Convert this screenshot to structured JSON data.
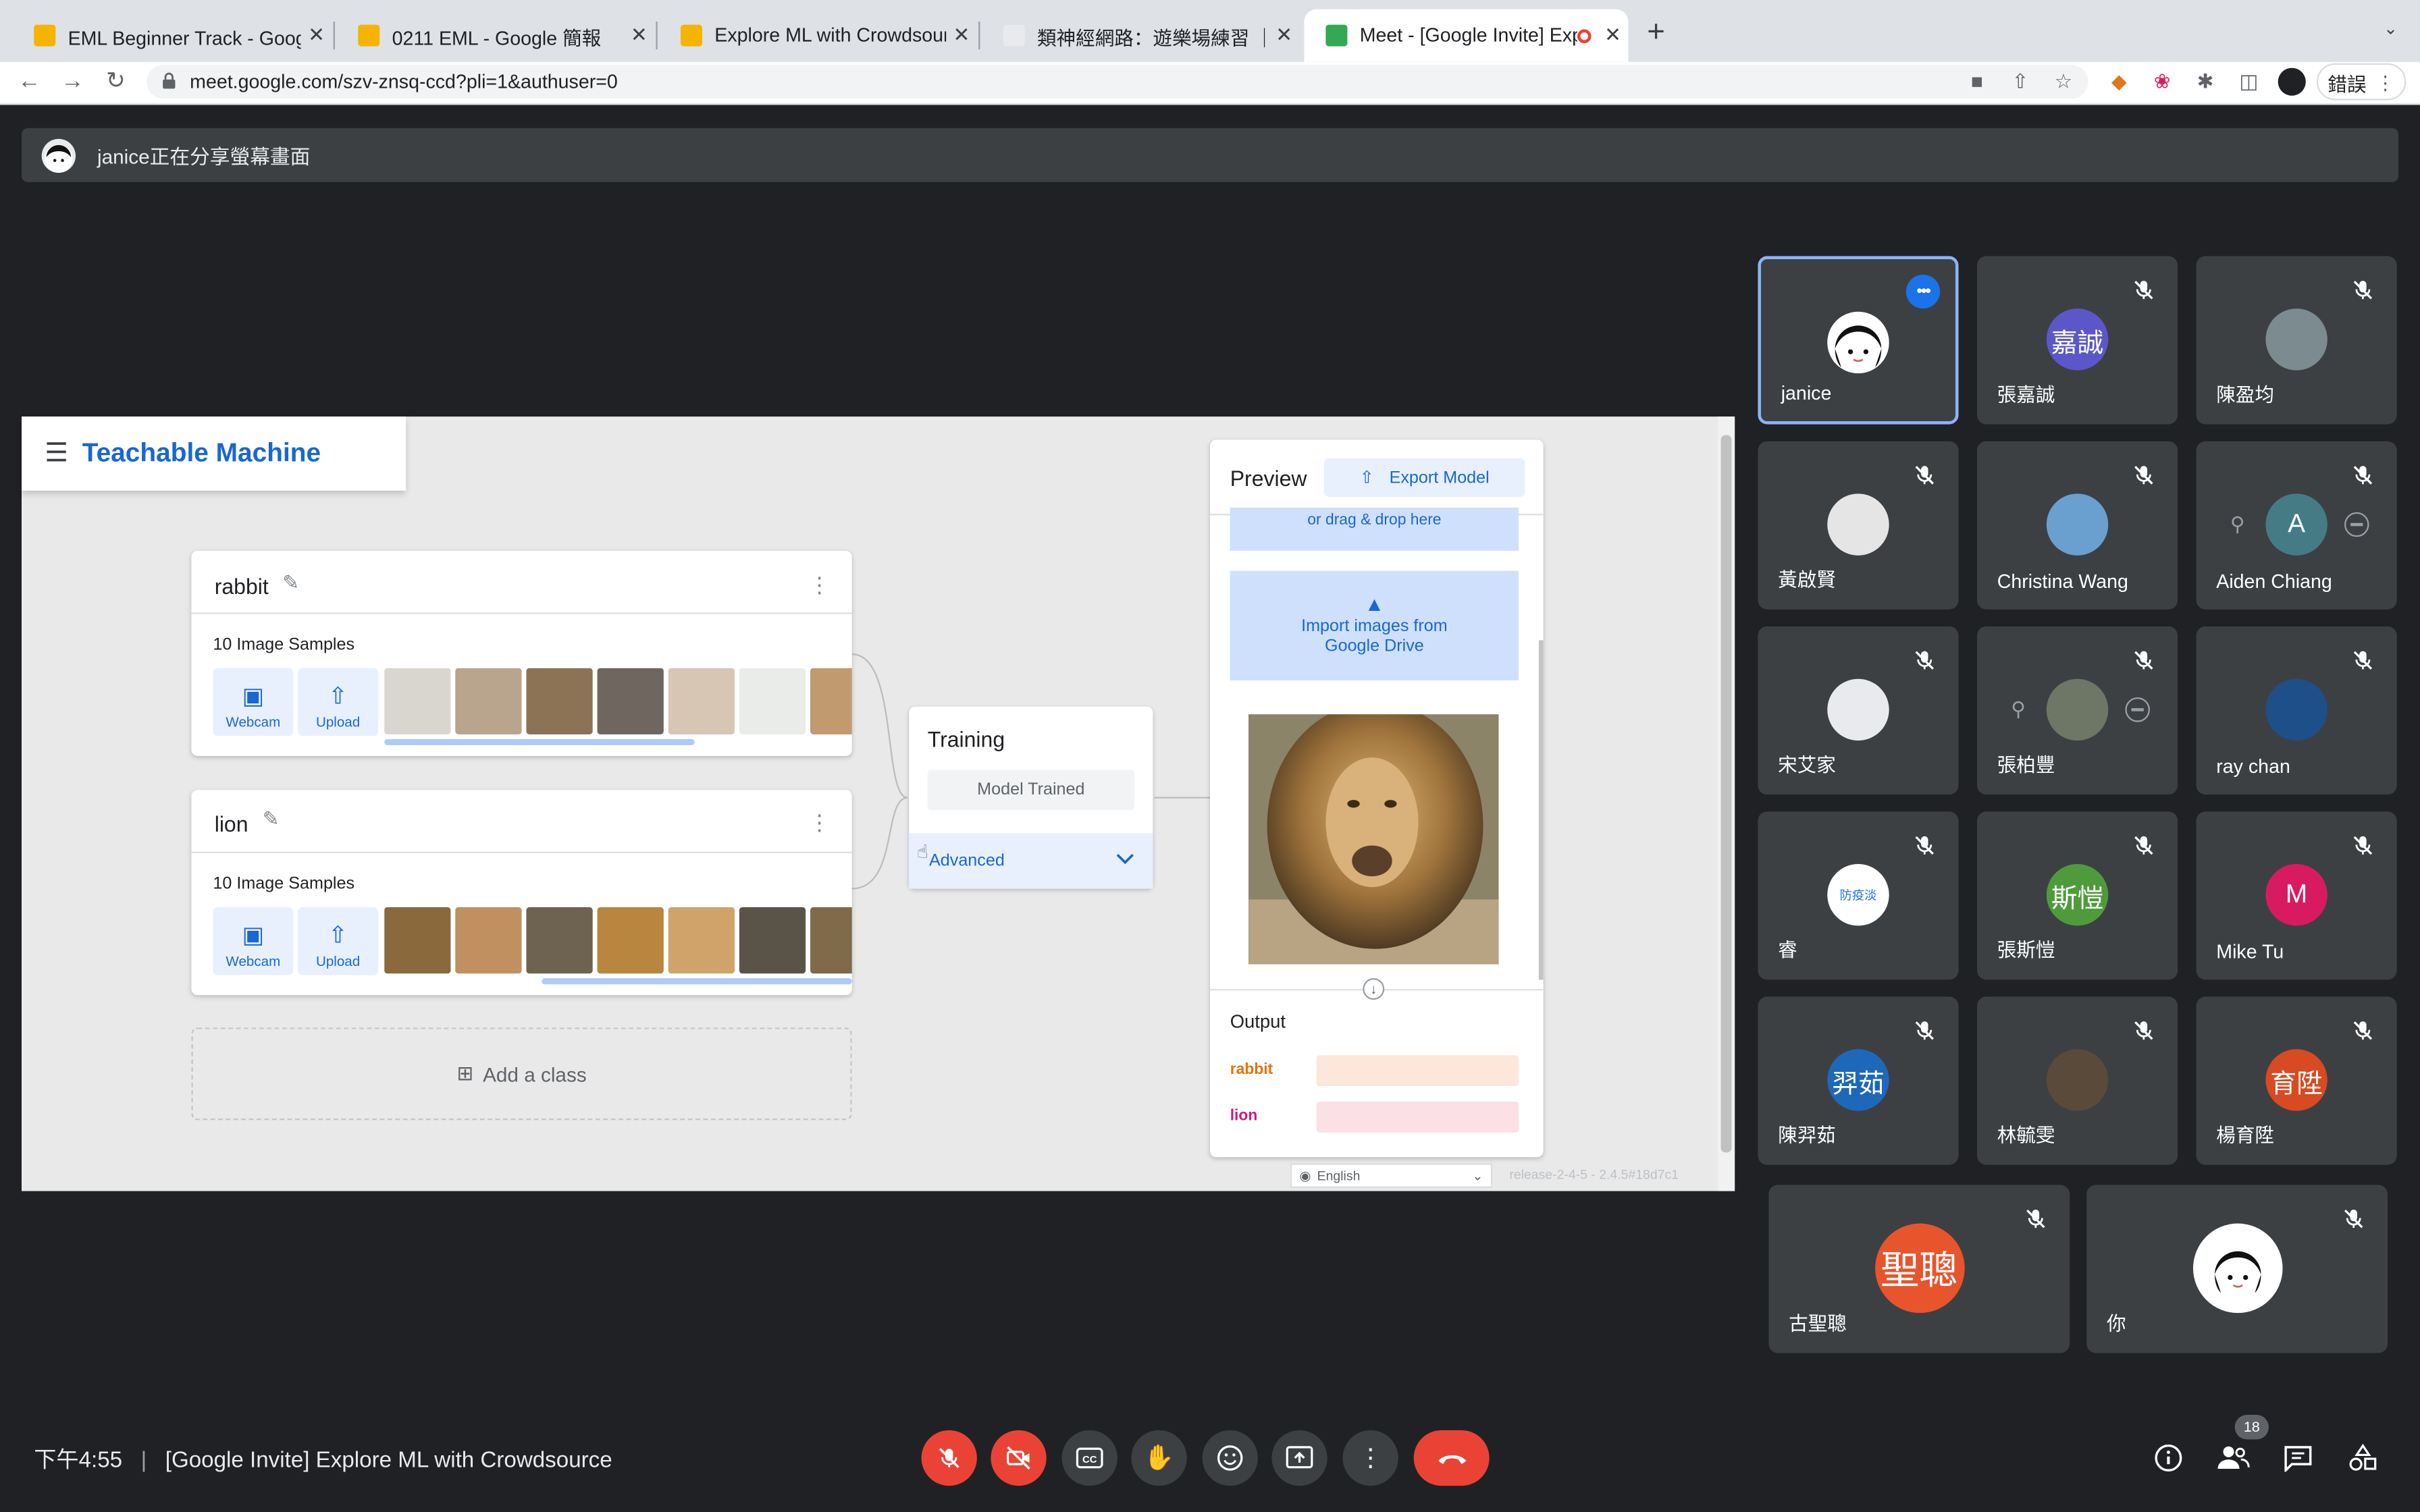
{
  "browser": {
    "tabs": [
      {
        "title": "EML Beginner Track - Google 簡",
        "fav_color": "#f4b400"
      },
      {
        "title": "0211 EML - Google 簡報",
        "fav_color": "#f4b400"
      },
      {
        "title": "Explore ML with Crowdsource V",
        "fav_color": "#f4b400"
      },
      {
        "title": "類神經網路：遊樂場練習 ｜ Mac",
        "fav_color": "#e8eaed"
      },
      {
        "title": "Meet - [Google Invite] Expl",
        "fav_color": "#34a853"
      }
    ],
    "url": "meet.google.com/szv-znsq-ccd?pli=1&authuser=0",
    "error_button": "錯誤"
  },
  "banner": {
    "text": "janice正在分享螢幕畫面"
  },
  "teachable": {
    "title": "Teachable Machine",
    "classes": [
      {
        "name": "rabbit",
        "samples": "10 Image Samples",
        "thumb_colors": [
          "#d9d6d0",
          "#b9a58e",
          "#8c7356",
          "#6f6660",
          "#d8c6b4",
          "#e9ece8",
          "#c19a70"
        ]
      },
      {
        "name": "lion",
        "samples": "10 Image Samples",
        "thumb_colors": [
          "#8a6a3c",
          "#c09060",
          "#6e6250",
          "#b8863e",
          "#cfa36a",
          "#5a5448",
          "#7f6a4a"
        ]
      }
    ],
    "webcam_label": "Webcam",
    "upload_label": "Upload",
    "add_class": "Add a class",
    "training": {
      "title": "Training",
      "button": "Model Trained",
      "advanced": "Advanced"
    },
    "preview": {
      "title": "Preview",
      "export": "Export Model",
      "drag_text": "or drag & drop here",
      "import_line1": "Import images from",
      "import_line2": "Google Drive",
      "output_title": "Output",
      "outputs": [
        {
          "label": "rabbit",
          "color": "#e8710a",
          "bar": "#fde7da"
        },
        {
          "label": "lion",
          "color": "#d01884",
          "bar": "#fbe0e6"
        }
      ]
    },
    "language": "English",
    "release": "release-2-4-5 - 2.4.5#18d7c1"
  },
  "participants": [
    {
      "name": "janice",
      "avatar_text": "",
      "avatar_color": "#ffffff",
      "selected": true
    },
    {
      "name": "張嘉誠",
      "avatar_text": "嘉誠",
      "avatar_color": "#5b57c9"
    },
    {
      "name": "陳盈均",
      "avatar_text": "",
      "avatar_color": "#7c8b8f"
    },
    {
      "name": "黃啟賢",
      "avatar_text": "",
      "avatar_color": "#e5e5e5"
    },
    {
      "name": "Christina Wang",
      "avatar_text": "",
      "avatar_color": "#6aa0cf"
    },
    {
      "name": "Aiden Chiang",
      "avatar_text": "A",
      "avatar_color": "#457b85",
      "pinnable": true
    },
    {
      "name": "宋艾家",
      "avatar_text": "",
      "avatar_color": "#e8eaed"
    },
    {
      "name": "張柏豐",
      "avatar_text": "",
      "avatar_color": "#6e7765",
      "pinnable": true
    },
    {
      "name": "ray chan",
      "avatar_text": "",
      "avatar_color": "#1f4f89"
    },
    {
      "name": "睿",
      "avatar_text": "防疫淡",
      "avatar_color": "#ffffff"
    },
    {
      "name": "張斯愷",
      "avatar_text": "斯愷",
      "avatar_color": "#4f9b3c"
    },
    {
      "name": "Mike Tu",
      "avatar_text": "M",
      "avatar_color": "#d81b60"
    },
    {
      "name": "陳羿茹",
      "avatar_text": "羿茹",
      "avatar_color": "#1e68b9"
    },
    {
      "name": "林毓雯",
      "avatar_text": "",
      "avatar_color": "#5a4a3a"
    },
    {
      "name": "楊育陞",
      "avatar_text": "育陞",
      "avatar_color": "#d84a21"
    },
    {
      "name": "古聖聰",
      "avatar_text": "聖聰",
      "avatar_color": "#e8542c"
    },
    {
      "name": "你",
      "avatar_text": "",
      "avatar_color": "#ffffff"
    }
  ],
  "bottom": {
    "time": "下午4:55",
    "separator": "|",
    "meeting_title": "[Google Invite] Explore ML with Crowdsource",
    "participant_count": "18"
  }
}
